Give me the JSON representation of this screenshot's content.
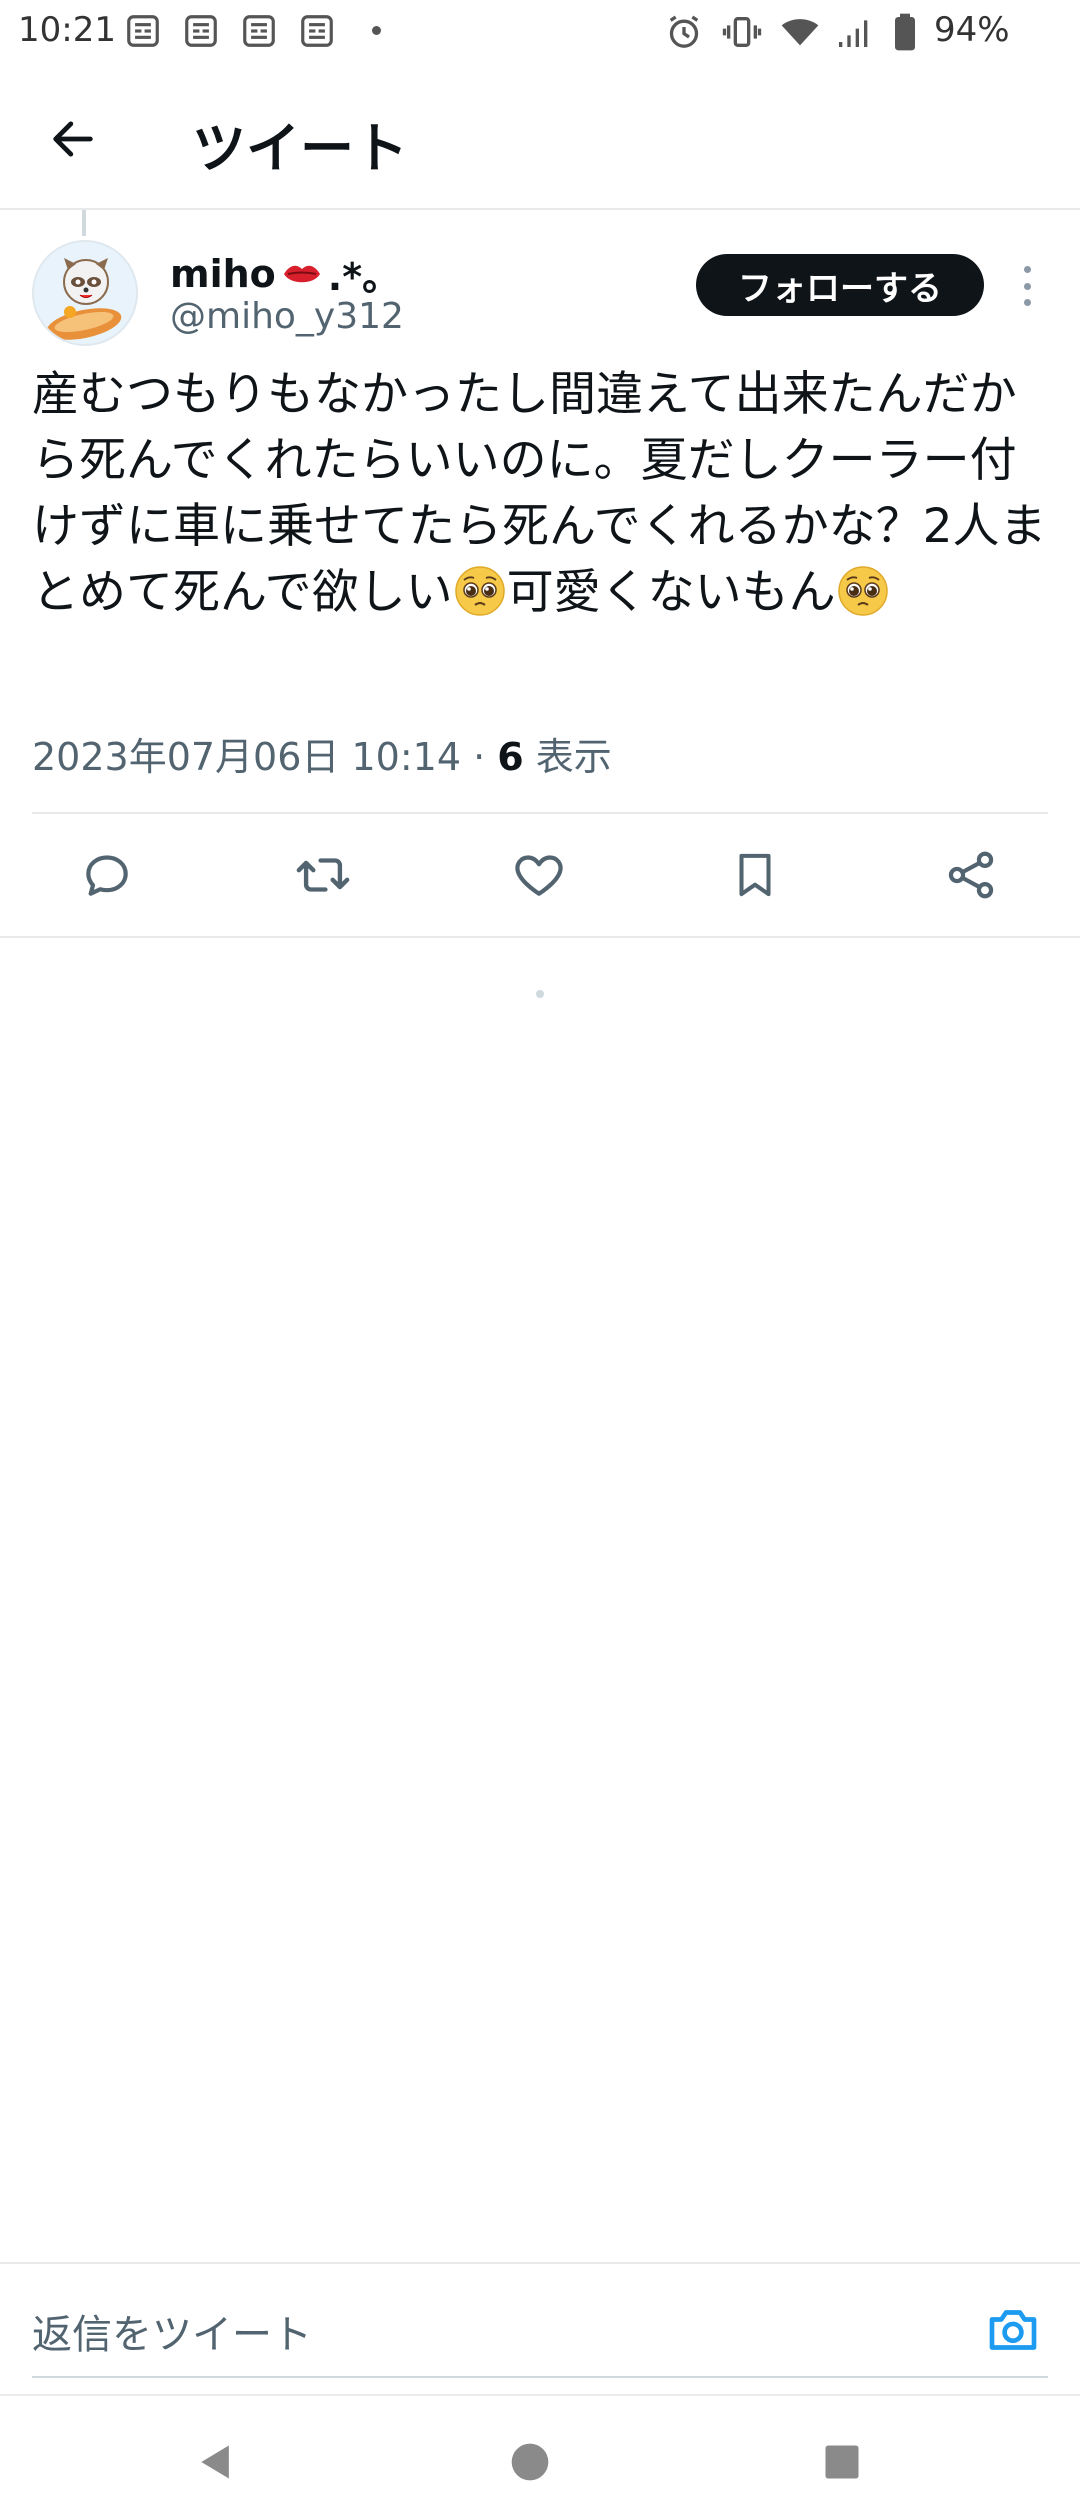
{
  "status_bar": {
    "time": "10:21",
    "battery_percent": "94%",
    "notification_icons": [
      "news-icon",
      "news-icon",
      "news-icon",
      "news-icon"
    ],
    "right_icons": [
      "alarm-icon",
      "vibrate-icon",
      "wifi-icon",
      "signal-icon",
      "battery-icon"
    ]
  },
  "header": {
    "title": "ツイート",
    "back_icon": "arrow-left-icon"
  },
  "tweet": {
    "author_name": "miho",
    "name_suffix": ".*。",
    "handle": "@miho_y312",
    "follow_label": "フォローする",
    "text_part1": "産むつもりもなかったし間違えて出来たんだから死んでくれたらいいのに。夏だしクーラー付けずに車に乗せてたら死んでくれるかな？2人まとめて死んで欲しい",
    "text_part2": "可愛くないもん",
    "timestamp": "2023年07月06日 10:14 · ",
    "views_count": "6",
    "views_label": " 表示"
  },
  "actions": [
    "reply-icon",
    "retweet-icon",
    "like-icon",
    "bookmark-icon",
    "share-icon"
  ],
  "reply_bar": {
    "placeholder": "返信をツイート",
    "camera_icon": "camera-icon"
  },
  "colors": {
    "text_primary": "#0f1419",
    "text_secondary": "#536471",
    "accent": "#1d9bf0",
    "divider": "#e7e9ea"
  },
  "nav": [
    "back-triangle-icon",
    "home-circle-icon",
    "recents-square-icon"
  ]
}
